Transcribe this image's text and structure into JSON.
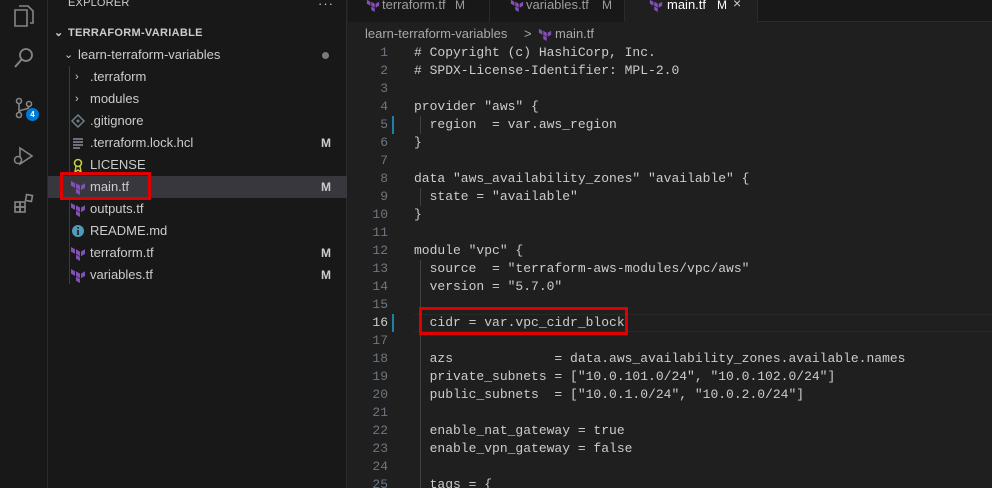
{
  "colors": {
    "accent": "#0078d4",
    "highlight_box": "#e00000",
    "terraform_icon": "#844fba",
    "modified_gutter": "#1b81a8"
  },
  "activity_bar": {
    "icons": [
      "explorer-icon",
      "search-icon",
      "source-control-icon",
      "run-debug-icon",
      "extensions-icon"
    ],
    "source_control_badge": "4"
  },
  "sidebar": {
    "title": "EXPLORER",
    "more": "···",
    "root": "TERRAFORM-VARIABLE",
    "folder": "learn-terraform-variables",
    "items": [
      {
        "label": ".terraform",
        "type": "folder",
        "icon": "chevron-right-icon",
        "mod": ""
      },
      {
        "label": "modules",
        "type": "folder",
        "icon": "chevron-right-icon",
        "mod": ""
      },
      {
        "label": ".gitignore",
        "type": "file",
        "icon": "git-icon",
        "mod": ""
      },
      {
        "label": ".terraform.lock.hcl",
        "type": "file",
        "icon": "lines-icon",
        "mod": "M"
      },
      {
        "label": "LICENSE",
        "type": "file",
        "icon": "license-icon",
        "mod": ""
      },
      {
        "label": "main.tf",
        "type": "file",
        "icon": "terraform-icon",
        "mod": "M"
      },
      {
        "label": "outputs.tf",
        "type": "file",
        "icon": "terraform-icon",
        "mod": ""
      },
      {
        "label": "README.md",
        "type": "file",
        "icon": "info-icon",
        "mod": ""
      },
      {
        "label": "terraform.tf",
        "type": "file",
        "icon": "terraform-icon",
        "mod": "M"
      },
      {
        "label": "variables.tf",
        "type": "file",
        "icon": "terraform-icon",
        "mod": "M"
      }
    ]
  },
  "tabs": [
    {
      "label": "terraform.tf",
      "mod": "M",
      "active": false
    },
    {
      "label": "variables.tf",
      "mod": "M",
      "active": false
    },
    {
      "label": "main.tf",
      "mod": "M",
      "active": true,
      "close": "×"
    }
  ],
  "breadcrumb": {
    "folder": "learn-terraform-variables",
    "separator": ">",
    "file": "main.tf"
  },
  "editor": {
    "current_line": 16,
    "lines": [
      {
        "n": "1",
        "text": "# Copyright (c) HashiCorp, Inc."
      },
      {
        "n": "2",
        "text": "# SPDX-License-Identifier: MPL-2.0"
      },
      {
        "n": "3",
        "text": ""
      },
      {
        "n": "4",
        "text": "provider \"aws\" {"
      },
      {
        "n": "5",
        "text": "  region  = var.aws_region"
      },
      {
        "n": "6",
        "text": "}"
      },
      {
        "n": "7",
        "text": ""
      },
      {
        "n": "8",
        "text": "data \"aws_availability_zones\" \"available\" {"
      },
      {
        "n": "9",
        "text": "  state = \"available\""
      },
      {
        "n": "10",
        "text": "}"
      },
      {
        "n": "11",
        "text": ""
      },
      {
        "n": "12",
        "text": "module \"vpc\" {"
      },
      {
        "n": "13",
        "text": "  source  = \"terraform-aws-modules/vpc/aws\""
      },
      {
        "n": "14",
        "text": "  version = \"5.7.0\""
      },
      {
        "n": "15",
        "text": ""
      },
      {
        "n": "16",
        "text": "  cidr = var.vpc_cidr_block"
      },
      {
        "n": "17",
        "text": ""
      },
      {
        "n": "18",
        "text": "  azs             = data.aws_availability_zones.available.names"
      },
      {
        "n": "19",
        "text": "  private_subnets = [\"10.0.101.0/24\", \"10.0.102.0/24\"]"
      },
      {
        "n": "20",
        "text": "  public_subnets  = [\"10.0.1.0/24\", \"10.0.2.0/24\"]"
      },
      {
        "n": "21",
        "text": ""
      },
      {
        "n": "22",
        "text": "  enable_nat_gateway = true"
      },
      {
        "n": "23",
        "text": "  enable_vpn_gateway = false"
      },
      {
        "n": "24",
        "text": ""
      },
      {
        "n": "25",
        "text": "  tags = {"
      }
    ]
  }
}
